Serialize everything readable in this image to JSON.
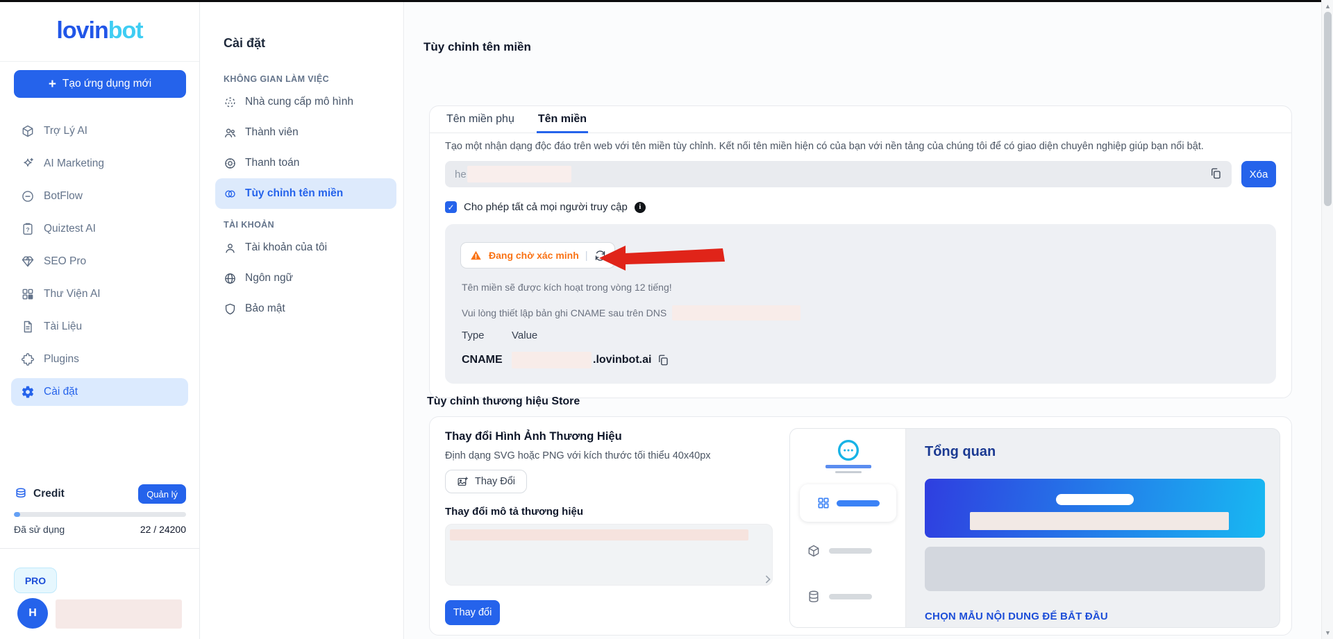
{
  "logo": {
    "primary": "lovin",
    "accent": "bot"
  },
  "sidebar": {
    "new_app_label": "Tạo ứng dụng mới",
    "items": [
      {
        "label": "Trợ Lý AI"
      },
      {
        "label": "AI Marketing"
      },
      {
        "label": "BotFlow"
      },
      {
        "label": "Quiztest AI"
      },
      {
        "label": "SEO Pro"
      },
      {
        "label": "Thư Viện AI"
      },
      {
        "label": "Tài Liệu"
      },
      {
        "label": "Plugins"
      },
      {
        "label": "Cài đặt"
      }
    ],
    "credit": {
      "title": "Credit",
      "manage_label": "Quản lý",
      "used_label": "Đã sử dụng",
      "used_value": "22 / 24200"
    },
    "plan_badge": "PRO",
    "avatar_initial": "H"
  },
  "nav": {
    "title": "Cài đặt",
    "section1": "KHÔNG GIAN LÀM VIỆC",
    "s1_items": [
      {
        "label": "Nhà cung cấp mô hình"
      },
      {
        "label": "Thành viên"
      },
      {
        "label": "Thanh toán"
      },
      {
        "label": "Tùy chỉnh tên miền"
      }
    ],
    "section2": "TÀI KHOẢN",
    "s2_items": [
      {
        "label": "Tài khoản của tôi"
      },
      {
        "label": "Ngôn ngữ"
      },
      {
        "label": "Bảo mật"
      }
    ]
  },
  "main": {
    "title": "Tùy chỉnh tên miền",
    "tabs": [
      {
        "label": "Tên miền phụ"
      },
      {
        "label": "Tên miền"
      }
    ],
    "description": "Tạo một nhận dạng độc đáo trên web với tên miền tùy chỉnh. Kết nối tên miền hiện có của bạn với nền tảng của chúng tôi để có giao diện chuyên nghiệp giúp bạn nổi bật.",
    "domain_input_value": "he",
    "delete_label": "Xóa",
    "checkbox_label": "Cho phép tất cả mọi người truy cập",
    "verification": {
      "status_label": "Đang chờ xác minh",
      "note1": "Tên miền sẽ được kích hoạt trong vòng 12 tiếng!",
      "note2": "Vui lòng thiết lập bản ghi CNAME sau trên DNS",
      "type_header": "Type",
      "value_header": "Value",
      "record_type": "CNAME",
      "value_suffix": ".lovinbot.ai"
    },
    "store": {
      "title": "Tùy chỉnh thương hiệu Store",
      "image_title": "Thay đổi Hình Ảnh Thương Hiệu",
      "image_hint": "Định dạng SVG hoặc PNG với kích thước tối thiểu 40x40px",
      "image_button": "Thay Đổi",
      "desc_label": "Thay đổi mô tả thương hiệu",
      "submit_button": "Thay đổi",
      "preview_title": "Tổng quan",
      "cta": "CHỌN MẪU NỘI DUNG ĐỂ BẮT ĐẦU"
    }
  },
  "colors": {
    "accent": "#2563eb",
    "logo_accent": "#3fcdf3",
    "active_bg": "#dbeafe",
    "warning": "#f97316",
    "arrow_red": "#e02419",
    "gradient_from": "#2f3ee0",
    "gradient_to": "#18b9f2"
  }
}
